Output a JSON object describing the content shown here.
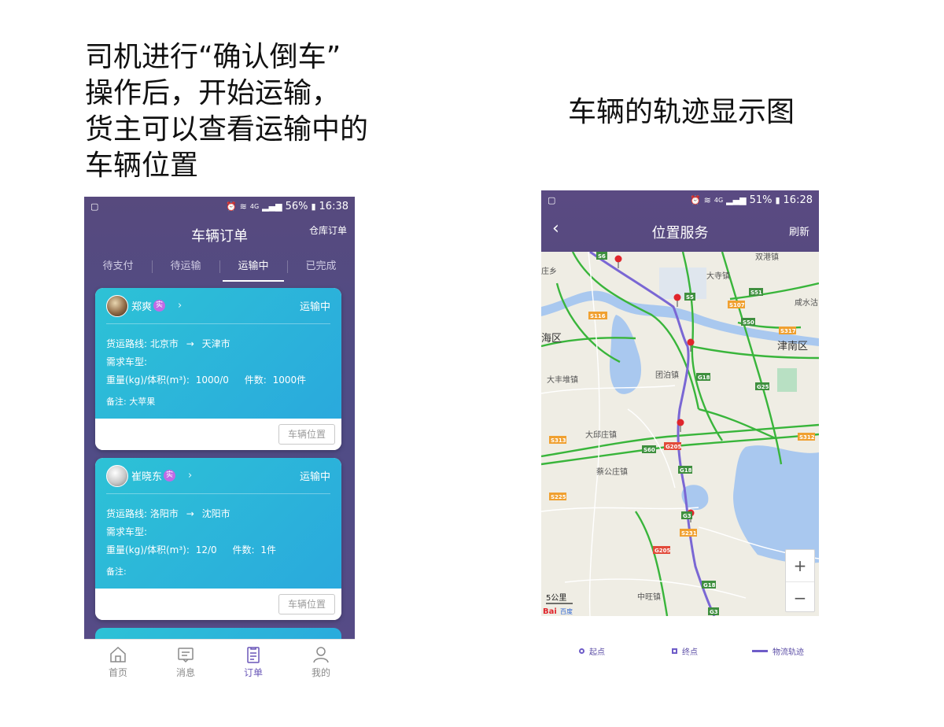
{
  "captions": {
    "left_lines": [
      "司机进行“确认倒车”",
      "操作后，开始运输，",
      "货主可以查看运输中的",
      "车辆位置"
    ],
    "right": "车辆的轨迹显示图"
  },
  "phone1": {
    "status": {
      "battery": "56%",
      "time": "16:38",
      "network": "4G"
    },
    "header": {
      "title": "车辆订单",
      "right_link": "仓库订单"
    },
    "tabs": [
      {
        "label": "待支付",
        "active": false
      },
      {
        "label": "待运输",
        "active": false
      },
      {
        "label": "运输中",
        "active": true
      },
      {
        "label": "已完成",
        "active": false
      }
    ],
    "orders": [
      {
        "user": "郑爽",
        "badge": "实",
        "status": "运输中",
        "route_label": "货运路线:",
        "from": "北京市",
        "arrow": "→",
        "to": "天津市",
        "vehicle_label": "需求车型:",
        "vehicle_value": "",
        "weight_label": "重量(kg)/体积(m³):",
        "weight_value": "1000/0",
        "count_label": "件数:",
        "count_value": "1000件",
        "note_label": "备注:",
        "note_value": "大苹果",
        "button": "车辆位置"
      },
      {
        "user": "崔晓东",
        "badge": "实",
        "status": "运输中",
        "route_label": "货运路线:",
        "from": "洛阳市",
        "arrow": "→",
        "to": "沈阳市",
        "vehicle_label": "需求车型:",
        "vehicle_value": "",
        "weight_label": "重量(kg)/体积(m³):",
        "weight_value": "12/0",
        "count_label": "件数:",
        "count_value": "1件",
        "note_label": "备注:",
        "note_value": "",
        "button": "车辆位置"
      }
    ],
    "nav": [
      {
        "label": "首页",
        "icon": "home-icon",
        "active": false
      },
      {
        "label": "消息",
        "icon": "message-icon",
        "active": false
      },
      {
        "label": "订单",
        "icon": "order-icon",
        "active": true
      },
      {
        "label": "我的",
        "icon": "user-icon",
        "active": false
      }
    ]
  },
  "phone2": {
    "status": {
      "battery": "51%",
      "time": "16:28",
      "network": "4G"
    },
    "header": {
      "back": "‹",
      "title": "位置服务",
      "refresh": "刷新"
    },
    "map": {
      "labels": [
        "双港镇",
        "庄乡",
        "大寺镇",
        "咸水沽",
        "海区",
        "津南区",
        "团泊镇",
        "大丰堆镇",
        "大邱庄镇",
        "蔡公庄镇",
        "中旺镇"
      ],
      "road_badges": [
        "S6",
        "S5",
        "S51",
        "S107",
        "S116",
        "S50",
        "S317",
        "G18",
        "G25",
        "S313",
        "S312",
        "S60",
        "G205",
        "G18",
        "S225",
        "G3",
        "S231",
        "G205",
        "G18",
        "G3"
      ],
      "scale": "5公里",
      "logo_bai": "Bai",
      "logo_du": "百度",
      "zoom_in": "+",
      "zoom_out": "−"
    },
    "legend": [
      {
        "label": "起点",
        "shape": "circle"
      },
      {
        "label": "终点",
        "shape": "square"
      },
      {
        "label": "物流轨迹",
        "shape": "line"
      }
    ]
  },
  "colors": {
    "brand_purple": "#574a7e",
    "card_cyan": "#2dc2d6",
    "track": "#6e5cc8",
    "active_nav": "#6a57b8"
  }
}
